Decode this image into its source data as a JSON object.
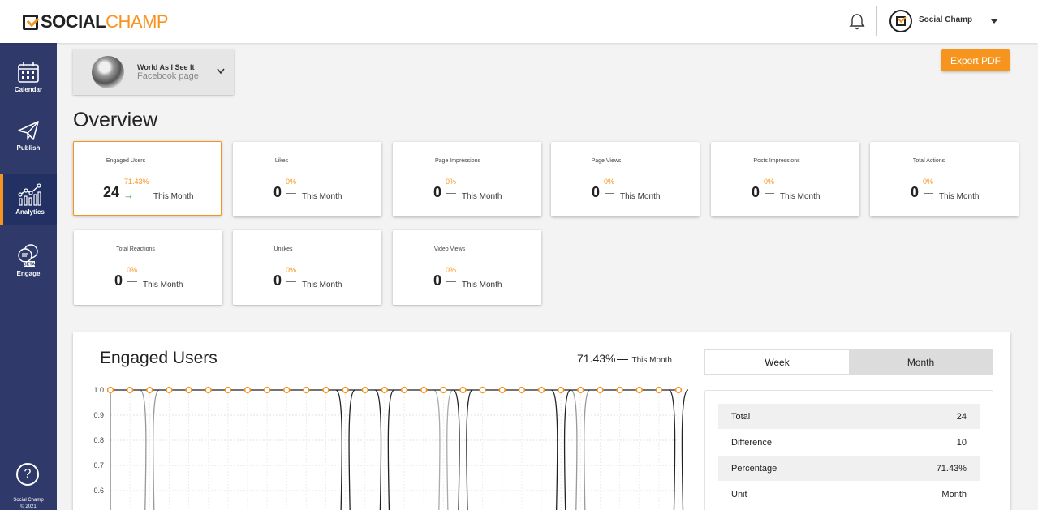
{
  "brand": {
    "social": "SOCIAL",
    "champ": "CHAMP"
  },
  "header": {
    "user_name": "Social Champ"
  },
  "sidebar": {
    "items": [
      {
        "label": "Calendar",
        "icon": "calendar-icon"
      },
      {
        "label": "Publish",
        "icon": "paper-plane-icon"
      },
      {
        "label": "Analytics",
        "icon": "analytics-icon"
      },
      {
        "label": "Engage",
        "icon": "chat-bubbles-icon",
        "badge": "BETA"
      }
    ],
    "footer": {
      "line1": "Social Champ",
      "line2": "© 2021"
    }
  },
  "page_selector": {
    "name": "World As I See It",
    "type": "Facebook page"
  },
  "export_label": "Export PDF",
  "overview_title": "Overview",
  "metrics": [
    {
      "title": "Engaged Users",
      "value": "24",
      "pct": "71.43%",
      "period": "This Month"
    },
    {
      "title": "Likes",
      "value": "0",
      "pct": "0%",
      "period": "This Month"
    },
    {
      "title": "Page Impressions",
      "value": "0",
      "pct": "0%",
      "period": "This Month"
    },
    {
      "title": "Page Views",
      "value": "0",
      "pct": "0%",
      "period": "This Month"
    },
    {
      "title": "Posts Impressions",
      "value": "0",
      "pct": "0%",
      "period": "This Month"
    },
    {
      "title": "Total Actions",
      "value": "0",
      "pct": "0%",
      "period": "This Month"
    },
    {
      "title": "Total Reactions",
      "value": "0",
      "pct": "0%",
      "period": "This Month"
    },
    {
      "title": "Unlikes",
      "value": "0",
      "pct": "0%",
      "period": "This Month"
    },
    {
      "title": "Video Views",
      "value": "0",
      "pct": "0%",
      "period": "This Month"
    }
  ],
  "panel": {
    "title": "Engaged Users",
    "summary_pct": "71.43%",
    "summary_period": "This Month",
    "toggle": [
      "Week",
      "Month"
    ],
    "selected_toggle": "Month",
    "stats": [
      {
        "label": "Total",
        "value": "24"
      },
      {
        "label": "Difference",
        "value": "10"
      },
      {
        "label": "Percentage",
        "value": "71.43%"
      },
      {
        "label": "Unit",
        "value": "Month"
      }
    ]
  },
  "colors": {
    "accent": "#f7941d",
    "sidebar": "#2f3a6b",
    "up": "#2e9e3b"
  },
  "chart_data": {
    "type": "line",
    "y_ticks": [
      "1.0",
      "0.9",
      "0.8",
      "0.7",
      "0.6"
    ],
    "ylim": [
      0.6,
      1.0
    ],
    "grid": true,
    "series": [
      {
        "values": [
          1,
          1,
          1,
          1,
          1,
          1,
          1,
          1,
          1,
          1,
          1,
          1,
          1,
          1,
          1,
          1,
          1,
          1,
          1,
          1,
          1,
          1,
          1,
          1,
          1,
          1,
          1,
          1,
          1,
          1
        ]
      }
    ]
  }
}
